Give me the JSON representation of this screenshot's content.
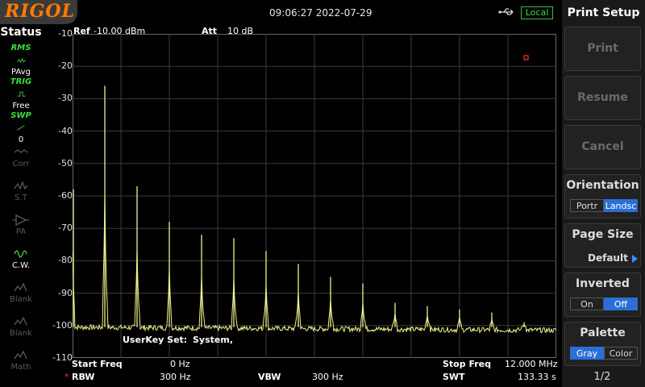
{
  "brand": "RIGOL",
  "datetime": "09:06:27 2022-07-29",
  "local_badge": "Local",
  "status": {
    "title": "Status",
    "items": [
      {
        "top": "RMS",
        "label": "PAvg",
        "icon": "average-trace-icon",
        "enabled": true
      },
      {
        "top": "TRIG",
        "label": "Free",
        "icon": "trigger-icon",
        "enabled": true
      },
      {
        "top": "SWP",
        "label": "0",
        "icon": "sweep-icon",
        "enabled": true
      },
      {
        "top": "",
        "label": "Corr",
        "icon": "correction-icon",
        "enabled": false
      },
      {
        "top": "",
        "label": "S.T",
        "icon": "signal-track-icon",
        "enabled": false
      },
      {
        "top": "",
        "label": "PA",
        "icon": "preamp-icon",
        "enabled": false
      },
      {
        "top": "",
        "label": "C.W.",
        "icon": "cw-icon",
        "enabled": true
      },
      {
        "top": "",
        "label": "Blank",
        "icon": "blank-trace-icon",
        "enabled": false
      },
      {
        "top": "",
        "label": "Blank",
        "icon": "blank-trace-icon",
        "enabled": false
      },
      {
        "top": "",
        "label": "Math",
        "icon": "math-trace-icon",
        "enabled": false
      }
    ]
  },
  "header": {
    "ref_label": "Ref",
    "ref_value": "-10.00 dBm",
    "att_label": "Att",
    "att_value": "10 dB"
  },
  "annotation": {
    "userkey_label": "UserKey Set:",
    "userkey_value": "System,"
  },
  "footer": {
    "start_label": "Start Freq",
    "start_value": "0 Hz",
    "stop_label": "Stop Freq",
    "stop_value": "12.000 MHz",
    "rbw_marker": "*",
    "rbw_label": "RBW",
    "rbw_value": "300 Hz",
    "vbw_label": "VBW",
    "vbw_value": "300 Hz",
    "swt_label": "SWT",
    "swt_value": "133.33 s"
  },
  "menu": {
    "title": "Print Setup",
    "print": "Print",
    "resume": "Resume",
    "cancel": "Cancel",
    "orientation": {
      "label": "Orientation",
      "opt1": "Portr",
      "opt2": "Landsc",
      "selected": "Landsc"
    },
    "page_size": {
      "label": "Page Size",
      "value": "Default"
    },
    "inverted": {
      "label": "Inverted",
      "opt1": "On",
      "opt2": "Off",
      "selected": "Off"
    },
    "palette": {
      "label": "Palette",
      "opt1": "Gray",
      "opt2": "Color",
      "selected": "Gray"
    },
    "page_indicator": "1/2"
  },
  "colors": {
    "trace": "#f0f08c",
    "grid": "#3c3c3c",
    "accent": "#2b6fd6",
    "brand": "#ff7a00",
    "status_green": "#3bdf3b"
  },
  "chart_data": {
    "type": "line",
    "x_unit": "MHz",
    "y_unit": "dBm",
    "xlim": [
      0,
      12
    ],
    "ylim": [
      -110,
      -10
    ],
    "yticks": [
      -10,
      -20,
      -30,
      -40,
      -50,
      -60,
      -70,
      -80,
      -90,
      -100,
      -110
    ],
    "grid": true,
    "noise_floor": -100.5,
    "peaks": [
      {
        "x": 0.0,
        "y": -58
      },
      {
        "x": 0.8,
        "y": -26
      },
      {
        "x": 1.6,
        "y": -57
      },
      {
        "x": 2.4,
        "y": -68
      },
      {
        "x": 3.2,
        "y": -72
      },
      {
        "x": 4.0,
        "y": -73
      },
      {
        "x": 4.8,
        "y": -77
      },
      {
        "x": 5.6,
        "y": -81
      },
      {
        "x": 6.4,
        "y": -85
      },
      {
        "x": 7.2,
        "y": -87
      },
      {
        "x": 8.0,
        "y": -93
      },
      {
        "x": 8.8,
        "y": -94
      },
      {
        "x": 9.6,
        "y": -95
      },
      {
        "x": 10.4,
        "y": -96
      },
      {
        "x": 11.2,
        "y": -99
      }
    ]
  }
}
